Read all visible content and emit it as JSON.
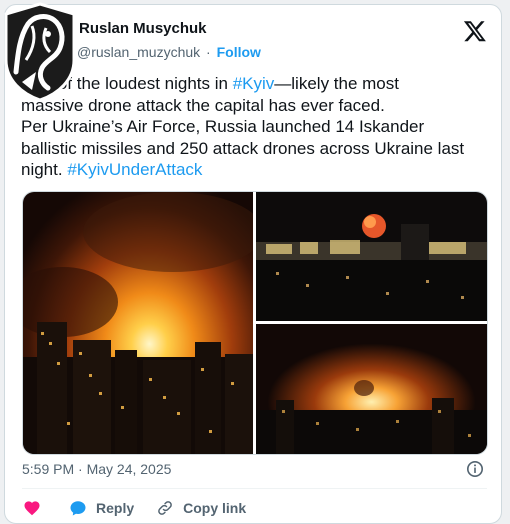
{
  "author": {
    "name": "Ruslan Musychuk",
    "handle": "@ruslan_muzychuk",
    "separator": "·",
    "follow_label": "Follow"
  },
  "tweet": {
    "line1_pre": "One of the loudest nights in ",
    "line1_tag": "#Kyiv",
    "line1_post": "—likely the most",
    "line2": "massive drone attack the capital has ever faced.",
    "line3": "Per Ukraine’s Air Force, Russia launched 14 Iskander",
    "line4": "ballistic missiles and 250 attack drones across Ukraine last",
    "line5_pre": "night. ",
    "line5_tag": "#KyivUnderAttack"
  },
  "timestamp": "5:59 PM · May 24, 2025",
  "actions": {
    "reply_label": "Reply",
    "copy_link_label": "Copy link"
  },
  "colors": {
    "accent": "#1d9bf0",
    "like": "#f91880",
    "muted": "#536471"
  },
  "icons": [
    "x-logo-icon",
    "info-icon",
    "heart-icon",
    "reply-icon",
    "link-icon",
    "lion-watermark-icon"
  ]
}
